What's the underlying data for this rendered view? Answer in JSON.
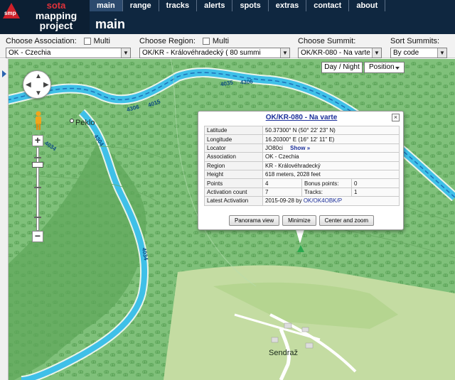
{
  "logo": {
    "sota": "sota",
    "mapping": "mapping",
    "project": "project",
    "mark": "smp"
  },
  "nav": {
    "tabs": [
      "main",
      "range",
      "tracks",
      "alerts",
      "spots",
      "extras",
      "contact",
      "about"
    ],
    "active": "main"
  },
  "page_title": "main",
  "selectors": {
    "association": {
      "label": "Choose Association:",
      "multi_label": "Multi",
      "value": "OK - Czechia"
    },
    "region": {
      "label": "Choose Region:",
      "multi_label": "Multi",
      "value": "OK/KR - Královéhradecký ( 80 summi"
    },
    "summit": {
      "label": "Choose Summit:",
      "value": "OK/KR-080 - Na varte"
    },
    "sort": {
      "label": "Sort Summits:",
      "value": "By code"
    }
  },
  "map_controls": {
    "day_night": "Day / Night",
    "position": "Position",
    "zoom_in": "+",
    "zoom_out": "−"
  },
  "map_labels": {
    "peklo": "Peklo",
    "sendraz": "Sendraž"
  },
  "river_labels": [
    "4035",
    "4306",
    "4306",
    "4015",
    "4034",
    "4304",
    "4034"
  ],
  "popup": {
    "title": "OK/KR-080 - Na varte",
    "close": "×",
    "rows": {
      "latitude": {
        "label": "Latitude",
        "value": "50.37300° N  (50° 22' 23\" N)"
      },
      "longitude": {
        "label": "Longitude",
        "value": "16.20300° E  (16° 12' 11\" E)"
      },
      "locator": {
        "label": "Locator",
        "value": "JO80ci",
        "link": "Show »"
      },
      "association": {
        "label": "Association",
        "value": "OK - Czechia"
      },
      "region": {
        "label": "Region",
        "value": "KR - Královéhradecký"
      },
      "height": {
        "label": "Height",
        "value": "618 meters, 2028 feet"
      },
      "points": {
        "label": "Points",
        "value": "4",
        "bonus_label": "Bonus points:",
        "bonus_value": "0"
      },
      "activations": {
        "label": "Activation count",
        "value": "7",
        "tracks_label": "Tracks:",
        "tracks_value": "1"
      },
      "latest": {
        "label": "Latest Activation",
        "value": "2015-09-28 by",
        "by": "OK/OK4OBK/P"
      }
    },
    "buttons": {
      "panorama": "Panorama view",
      "minimize": "Minimize",
      "center": "Center and zoom"
    }
  },
  "colors": {
    "header_bg": "#0f2740",
    "accent_red": "#d0202a",
    "forest": "#7fc07a",
    "river": "#3fc0e8",
    "link": "#1b2f9a"
  }
}
